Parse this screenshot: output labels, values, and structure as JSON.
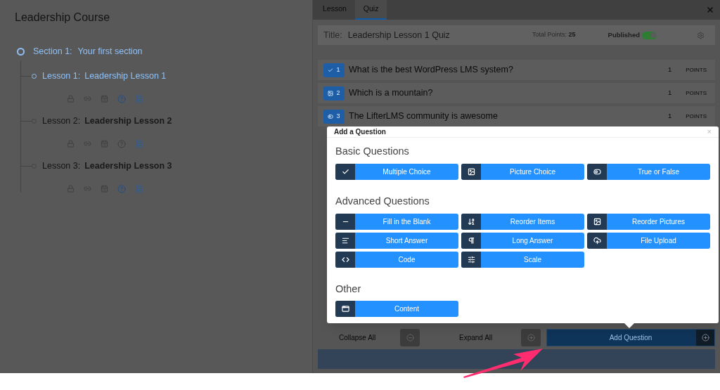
{
  "course": {
    "title": "Leadership Course",
    "section": {
      "label": "Section 1:",
      "title": "Your first section",
      "selected": true
    },
    "lessons": [
      {
        "label": "Lesson 1:",
        "title": "Leadership Lesson 1",
        "selected": true,
        "quiz": true,
        "content": true
      },
      {
        "label": "Lesson 2:",
        "title": "Leadership Lesson 2",
        "selected": false,
        "quiz": false,
        "content": true
      },
      {
        "label": "Lesson 3:",
        "title": "Leadership Lesson 3",
        "selected": false,
        "quiz": true,
        "content": true
      }
    ]
  },
  "tabs": [
    {
      "label": "Lesson",
      "selected": false
    },
    {
      "label": "Quiz",
      "selected": true
    }
  ],
  "quiz": {
    "title_label": "Title:",
    "title": "Leadership Lesson 1 Quiz",
    "total_label": "Total Points:",
    "total": "25",
    "published": {
      "label": "Published",
      "on": true
    }
  },
  "questions": [
    {
      "kind": "check",
      "number": "1",
      "text": "What is the best WordPress LMS system?",
      "points": "1",
      "unit": "POINTS"
    },
    {
      "kind": "image",
      "number": "2",
      "text": "Which is a mountain?",
      "points": "1",
      "unit": "POINTS"
    },
    {
      "kind": "toggle",
      "number": "3",
      "text": "The LifterLMS community is awesome",
      "points": "1",
      "unit": "POINTS"
    }
  ],
  "dialog": {
    "title": "Add a Question",
    "close": "×",
    "groups": [
      {
        "title": "Basic Questions",
        "types": [
          {
            "kind": "check",
            "label": "Multiple Choice"
          },
          {
            "kind": "image",
            "label": "Picture Choice"
          },
          {
            "kind": "toggle",
            "label": "True or False"
          }
        ]
      },
      {
        "title": "Advanced Questions",
        "types": [
          {
            "kind": "blank",
            "label": "Fill in the Blank"
          },
          {
            "kind": "sort",
            "label": "Reorder Items"
          },
          {
            "kind": "image",
            "label": "Reorder Pictures"
          },
          {
            "kind": "lines",
            "label": "Short Answer"
          },
          {
            "kind": "pilcrow",
            "label": "Long Answer"
          },
          {
            "kind": "upload",
            "label": "File Upload"
          },
          {
            "kind": "code",
            "label": "Code"
          },
          {
            "kind": "sliders",
            "label": "Scale"
          }
        ]
      },
      {
        "title": "Other",
        "types": [
          {
            "kind": "window",
            "label": "Content"
          }
        ]
      }
    ]
  },
  "footer": {
    "collapse": "Collapse All",
    "expand": "Expand All",
    "add": "Add Question"
  }
}
